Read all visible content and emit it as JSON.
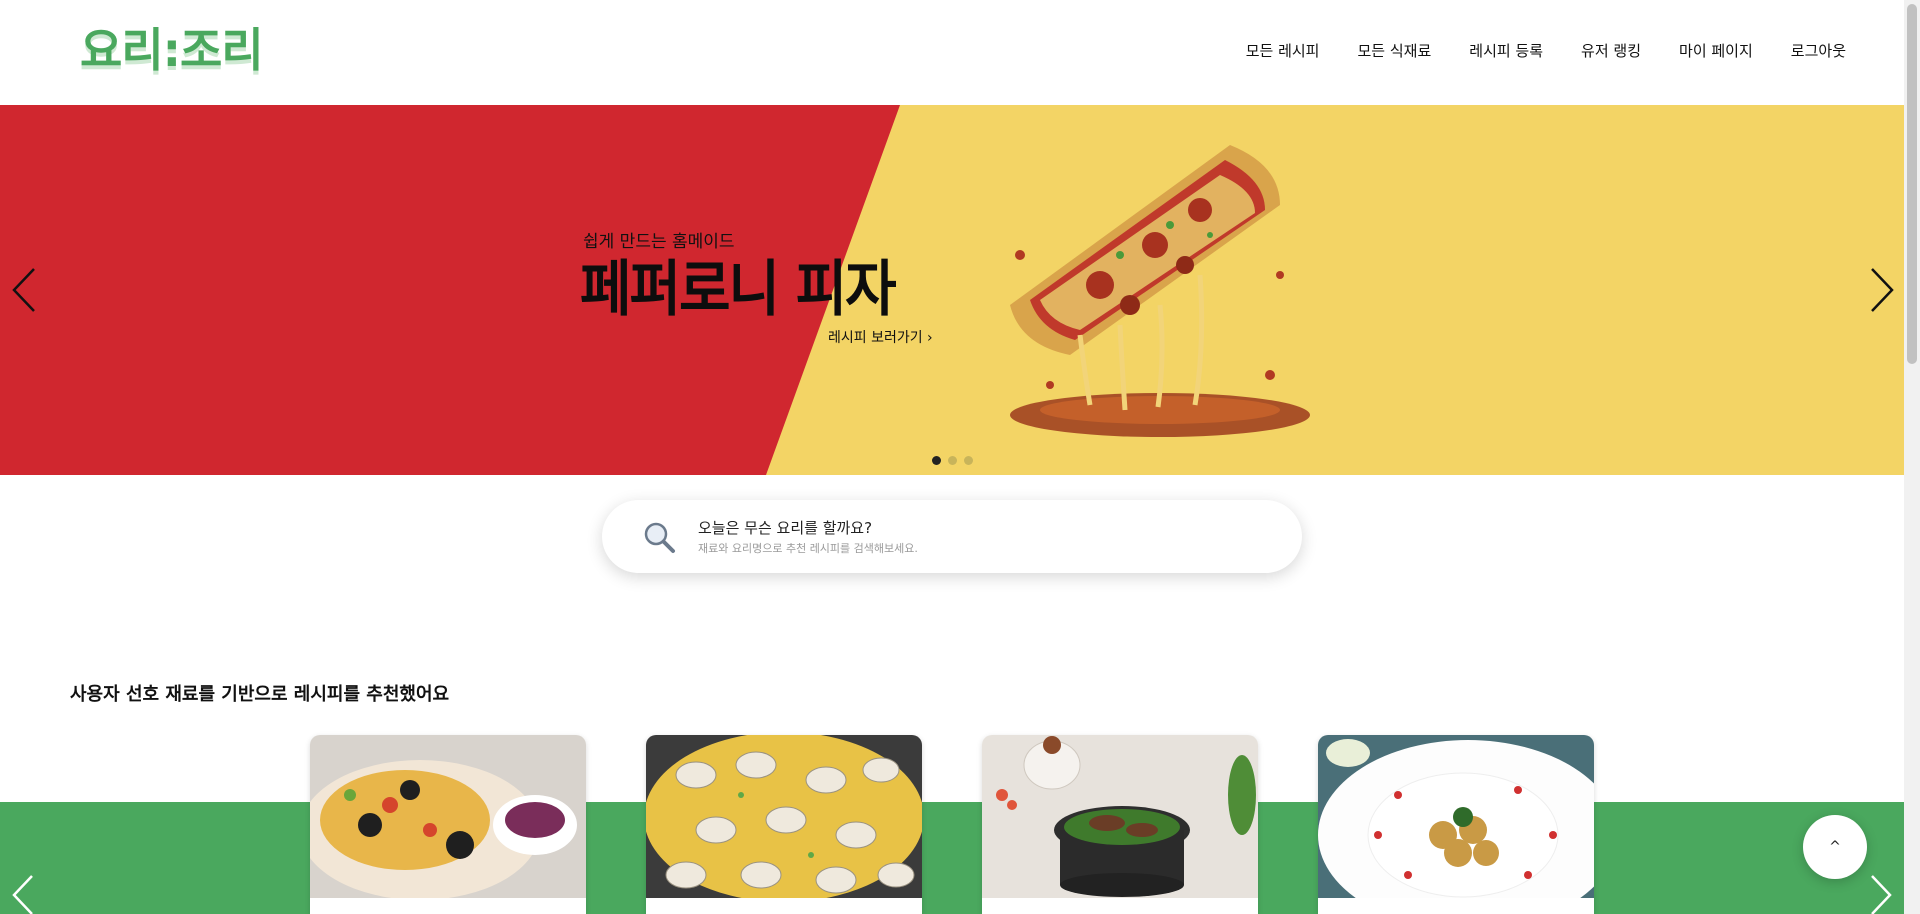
{
  "header": {
    "logo": "요리:조리",
    "nav": [
      "모든 레시피",
      "모든 식재료",
      "레시피 등록",
      "유저 랭킹",
      "마이 페이지",
      "로그아웃"
    ]
  },
  "hero": {
    "subtitle": "쉽게 만드는 홈메이드",
    "title": "페퍼로니 피자",
    "link": "레시피 보러가기 ›",
    "slide_count": 3,
    "active_slide": 1,
    "colors": {
      "left": "#d0272f",
      "right": "#f3d465"
    }
  },
  "search": {
    "title": "오늘은 무슨 요리를 할까요?",
    "hint": "재료와 요리명으로 추천 레시피를 검색해보세요."
  },
  "recommend": {
    "title": "사용자 선호 재료를 기반으로 레시피를 추천했어요",
    "band_color": "#4aa85e",
    "cards": [
      {
        "name": "card-pizza-olive"
      },
      {
        "name": "card-clam-dish"
      },
      {
        "name": "card-pot-rice"
      },
      {
        "name": "card-croquette"
      }
    ]
  },
  "top_button": "^"
}
